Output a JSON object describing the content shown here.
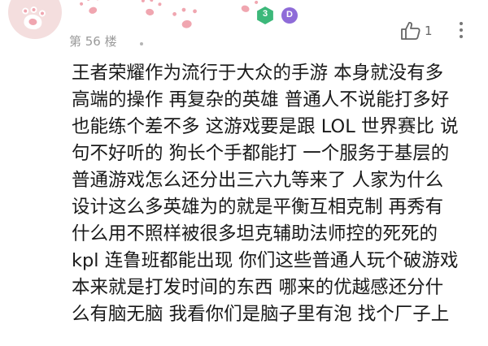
{
  "header": {
    "level": "3",
    "vip_mark": "D",
    "floor_label": "第 56 楼",
    "like_count": "1"
  },
  "colors": {
    "avatar_bg": "#f4dede",
    "paw_pad": "#ffffff",
    "paw_pink": "#f0a6b0",
    "level_badge": "#3cb87a",
    "vip_badge": "#8e6bd8",
    "secondary_text": "#9a9a9a",
    "body_text": "#1a1a1a"
  },
  "icons": {
    "avatar": "paw-avatar",
    "banner": "paw-pattern-banner",
    "level": "level-hexagon",
    "vip": "vip-badge",
    "like": "thumbs-up-icon",
    "more": "more-vertical-icon"
  },
  "comment": {
    "lines": [
      "王者荣耀作为流行于大众的手游 本身就没有多",
      "高端的操作 再复杂的英雄 普通人不说能打多好",
      "也能练个差不多 这游戏要是跟 LOL 世界赛比 说",
      "句不好听的 狗长个手都能打 一个服务于基层的",
      "普通游戏怎么还分出三六九等来了 人家为什么",
      "设计这么多英雄为的就是平衡互相克制 再秀有",
      "什么用不照样被很多坦克辅助法师控的死死的",
      "kpl 连鲁班都能出现 你们这些普通人玩个破游戏",
      "本来就是打发时间的东西 哪来的优越感还分什",
      "么有脑无脑 我看你们是脑子里有泡 找个厂子上"
    ]
  }
}
